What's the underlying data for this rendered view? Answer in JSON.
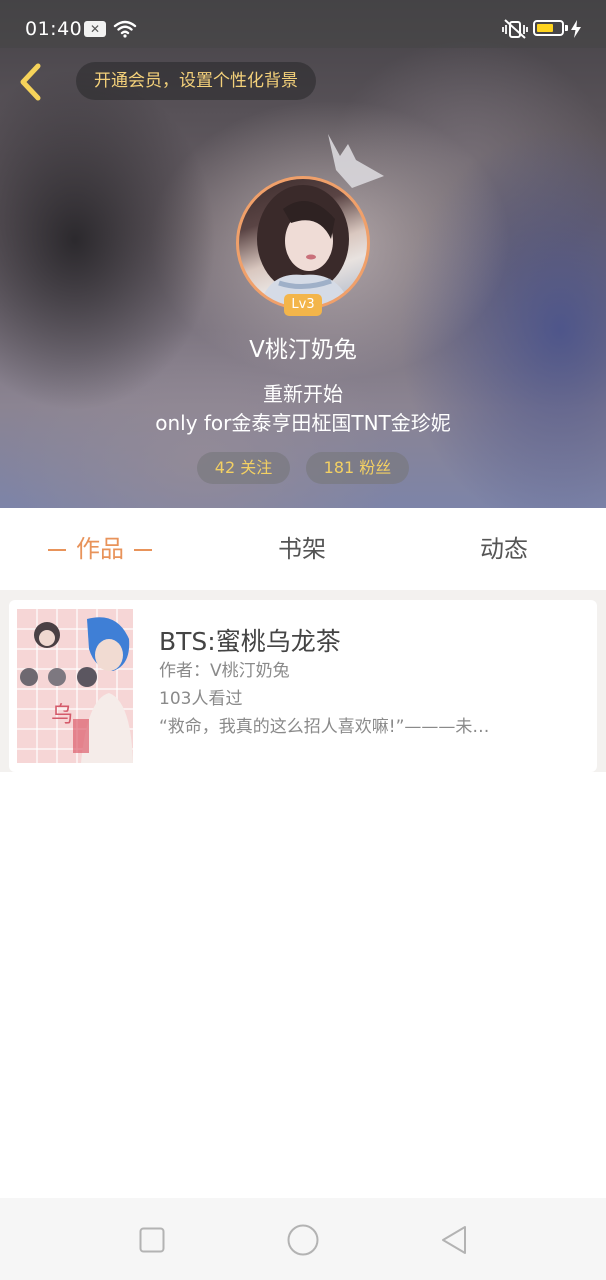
{
  "status_bar": {
    "time": "01:40",
    "battery_level": 0.7,
    "icons": [
      "message-notification-icon",
      "wifi-icon",
      "vibrate-icon",
      "battery-icon",
      "charging-icon"
    ]
  },
  "header": {
    "back_icon": "chevron-left-icon",
    "vip_prompt": "开通会员，设置个性化背景",
    "level_badge": "Lv3",
    "nickname": "V桃汀奶兔",
    "bio_line1": "重新开始",
    "bio_line2": "only for金泰亨田柾国TNT金珍妮",
    "following_label": "42 关注",
    "fans_label": "181 粉丝"
  },
  "tabs": [
    {
      "label": "作品",
      "active": true
    },
    {
      "label": "书架",
      "active": false
    },
    {
      "label": "动态",
      "active": false
    }
  ],
  "works": [
    {
      "title": "BTS:蜜桃乌龙茶",
      "author": "作者：V桃汀奶兔",
      "views": "103人看过",
      "excerpt": "“救命，我真的这么招人喜欢嘛!”———未…"
    }
  ],
  "nav_bar": {
    "icons": [
      "recent-apps-square-icon",
      "home-circle-icon",
      "back-triangle-icon"
    ]
  },
  "colors": {
    "accent_orange": "#e8935a",
    "vip_gold": "#f4d17a",
    "stat_yellow": "#f3d063",
    "level_badge": "#f3b54a"
  }
}
